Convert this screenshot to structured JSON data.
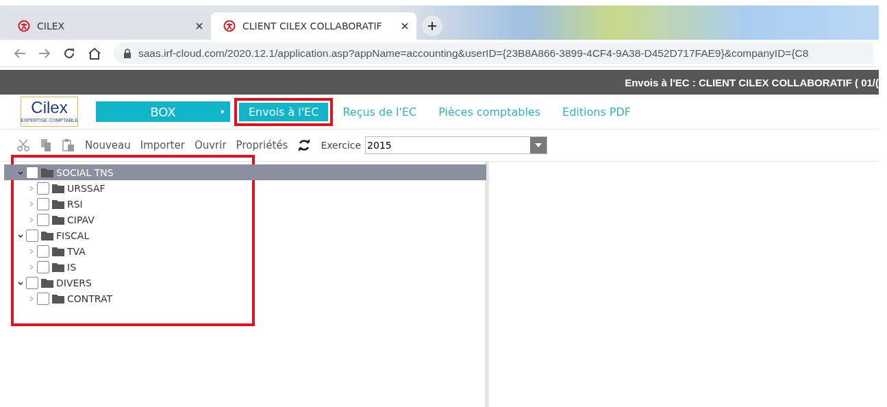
{
  "browser_tabs": [
    {
      "title": "CILEX",
      "selected": false
    },
    {
      "title": "CLIENT CILEX COLLABORATIF",
      "selected": true
    }
  ],
  "address_bar": {
    "url": "saas.irf-cloud.com/2020.12.1/application.asp?appName=accounting&userID={23B8A866-3899-4CF4-9A38-D452D717FAE9}&companyID={C8"
  },
  "header": {
    "title": "Envois à l'EC : CLIENT CILEX COLLABORATIF ( 01/("
  },
  "logo": {
    "name": "Cilex",
    "tagline": "EXPERTISE COMPTABLE"
  },
  "nav": {
    "box_button": "BOX",
    "items": [
      {
        "label": "Envois à l'EC",
        "selected": true,
        "highlighted": true
      },
      {
        "label": "Reçus de l'EC",
        "selected": false,
        "highlighted": false
      },
      {
        "label": "Pièces comptables",
        "selected": false,
        "highlighted": false
      },
      {
        "label": "Editions PDF",
        "selected": false,
        "highlighted": false
      }
    ]
  },
  "toolbar": {
    "actions": [
      "Nouveau",
      "Importer",
      "Ouvrir",
      "Propriétés"
    ],
    "exercice_label": "Exercice",
    "exercice_value": "2015"
  },
  "tree": {
    "highlighted": true,
    "items": [
      {
        "label": "SOCIAL TNS",
        "selected": true,
        "checked": false,
        "expanded": true,
        "children": [
          {
            "label": "URSSAF",
            "selected": false,
            "checked": false,
            "expanded": false
          },
          {
            "label": "RSI",
            "selected": false,
            "checked": false,
            "expanded": false
          },
          {
            "label": "CIPAV",
            "selected": false,
            "checked": false,
            "expanded": false
          }
        ]
      },
      {
        "label": "FISCAL",
        "selected": false,
        "checked": false,
        "expanded": true,
        "children": [
          {
            "label": "TVA",
            "selected": false,
            "checked": false,
            "expanded": false
          },
          {
            "label": "IS",
            "selected": false,
            "checked": false,
            "expanded": false
          }
        ]
      },
      {
        "label": "DIVERS",
        "selected": false,
        "checked": false,
        "expanded": true,
        "children": [
          {
            "label": "CONTRAT",
            "selected": false,
            "checked": false,
            "expanded": false
          }
        ]
      }
    ]
  }
}
